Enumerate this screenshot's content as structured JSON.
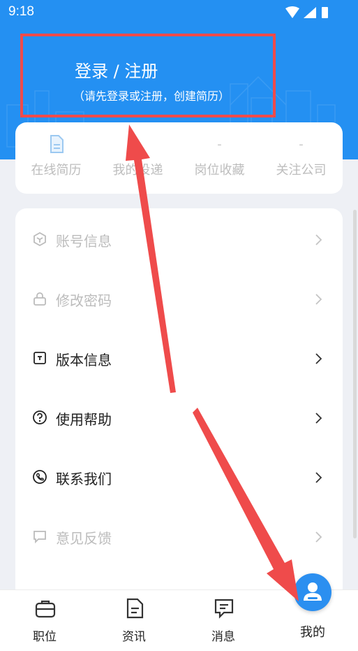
{
  "status_bar": {
    "time": "9:18"
  },
  "header": {
    "login_title": "登录 / 注册",
    "login_subtitle": "（请先登录或注册，创建简历）"
  },
  "stats": [
    {
      "value": "",
      "label": "在线简历",
      "icon": "document-icon"
    },
    {
      "value": "",
      "label": "我的投递"
    },
    {
      "value": "-",
      "label": "岗位收藏"
    },
    {
      "value": "-",
      "label": "关注公司"
    }
  ],
  "menu": [
    {
      "label": "账号信息",
      "icon": "cube-icon"
    },
    {
      "label": "修改密码",
      "icon": "lock-icon"
    },
    {
      "label": "版本信息",
      "icon": "version-icon"
    },
    {
      "label": "使用帮助",
      "icon": "help-icon"
    },
    {
      "label": "联系我们",
      "icon": "phone-icon"
    },
    {
      "label": "意见反馈",
      "icon": "chat-icon"
    }
  ],
  "bottom_nav": [
    {
      "label": "职位",
      "icon": "briefcase-icon"
    },
    {
      "label": "资讯",
      "icon": "news-icon"
    },
    {
      "label": "消息",
      "icon": "message-icon"
    },
    {
      "label": "我的",
      "icon": "user-icon"
    }
  ],
  "colors": {
    "primary": "#2490f2",
    "annotation": "#ef4b4b"
  }
}
